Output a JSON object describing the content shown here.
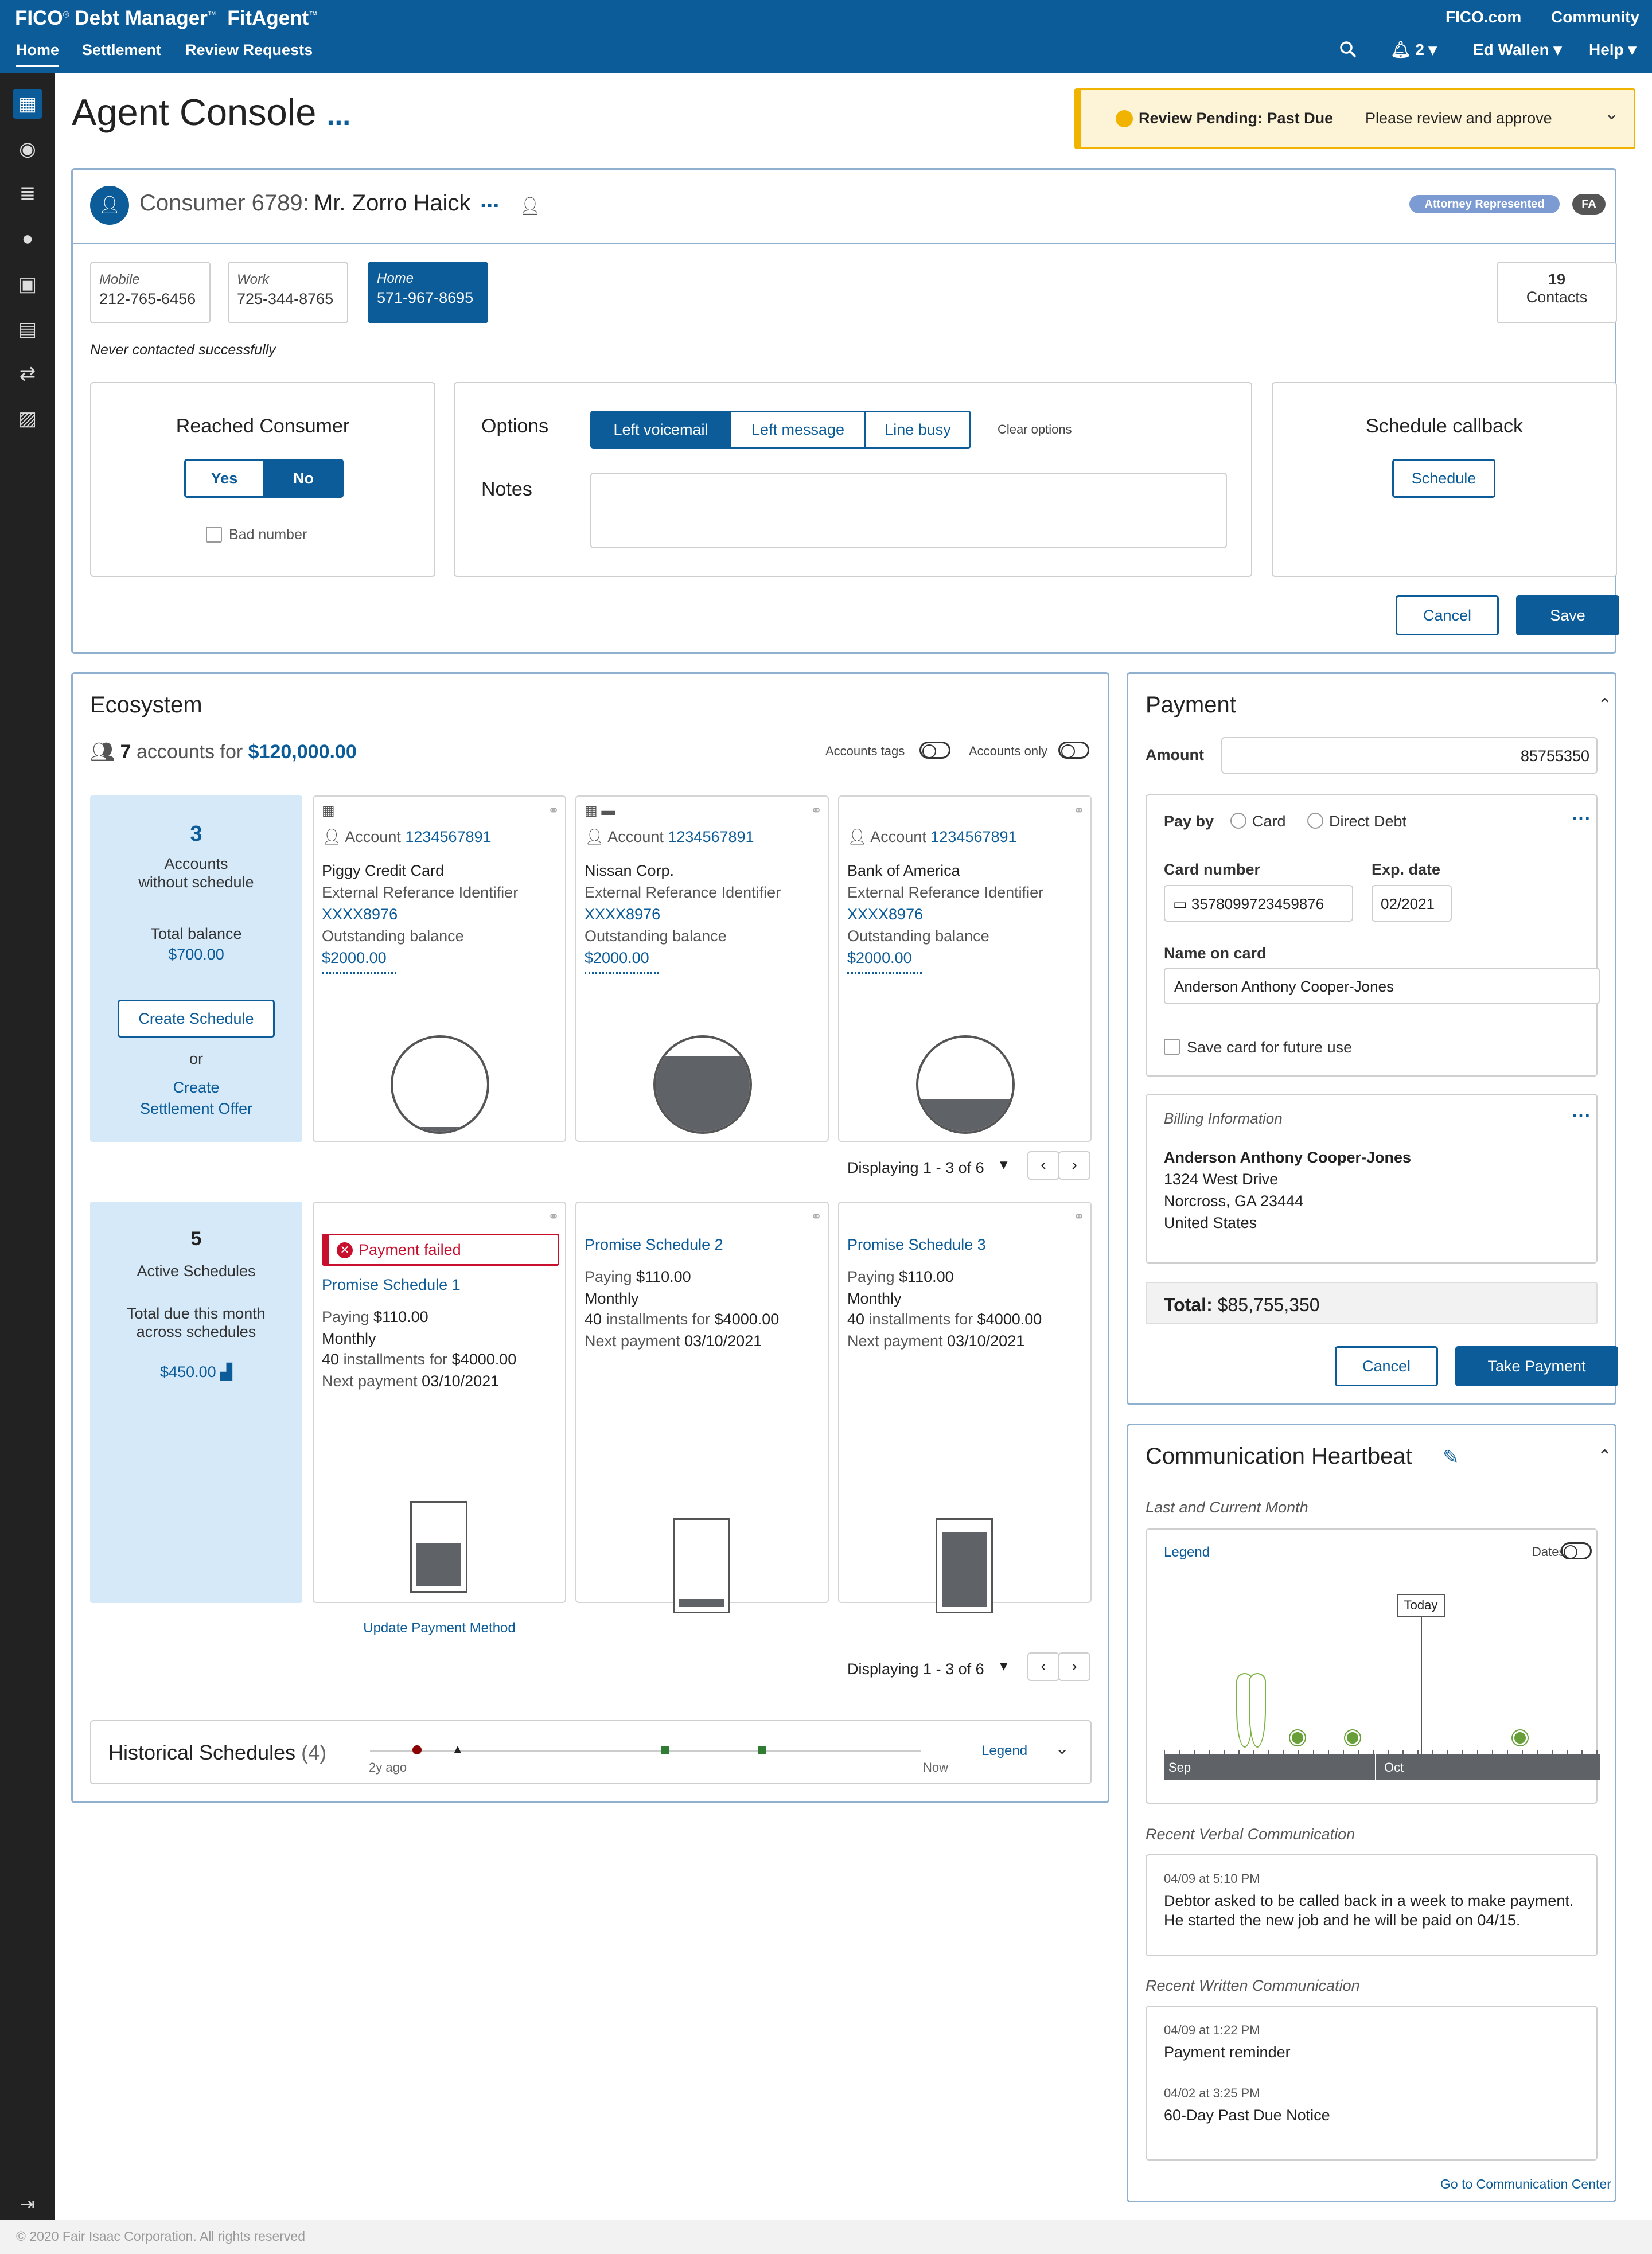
{
  "app": {
    "brand": "FICO",
    "brand_reg": "®",
    "product": "Debt Manager",
    "product_tm": "™",
    "sub": "FitAgent",
    "sub_tm": "™",
    "nav": [
      "Home",
      "Settlement",
      "Review Requests"
    ],
    "links": [
      "FICO.com",
      "Community"
    ],
    "notif_count": "2",
    "user": "Ed Wallen",
    "help": "Help"
  },
  "page": {
    "title": "Agent Console",
    "title_menu": "...",
    "alert": {
      "title": "Review Pending: Past Due",
      "text": "Please review and approve"
    }
  },
  "consumer": {
    "id_label": "Consumer 6789:",
    "name": "Mr. Zorro Haick",
    "menu": "...",
    "badges": {
      "attorney": "Attorney Represented",
      "fa": "FA"
    },
    "phones": [
      {
        "type": "Mobile",
        "number": "212-765-6456"
      },
      {
        "type": "Work",
        "number": "725-344-8765"
      },
      {
        "type": "Home",
        "number": "571-967-8695"
      }
    ],
    "contacts_count": "19",
    "contacts_label": "Contacts",
    "never_contacted": "Never contacted successfully",
    "reached": {
      "title": "Reached Consumer",
      "yes": "Yes",
      "no": "No",
      "bad_number": "Bad number"
    },
    "options": {
      "title": "Options",
      "buttons": [
        "Left voicemail",
        "Left message",
        "Line busy"
      ],
      "clear": "Clear options",
      "notes_label": "Notes",
      "notes_value": ""
    },
    "callback": {
      "title": "Schedule callback",
      "button": "Schedule"
    },
    "cancel": "Cancel",
    "save": "Save"
  },
  "ecosystem": {
    "title": "Ecosystem",
    "count": "7",
    "count_text": "accounts for",
    "total": "$120,000.00",
    "toggles": [
      "Accounts tags",
      "Accounts only"
    ],
    "summary1": {
      "num": "3",
      "line1": "Accounts",
      "line2": "without schedule",
      "total_label": "Total balance",
      "total": "$700.00",
      "create": "Create Schedule",
      "or": "or",
      "offer1": "Create",
      "offer2": "Settlement Offer"
    },
    "accounts": [
      {
        "acct_label": "Account",
        "acct_no": "1234567891",
        "name": "Piggy Credit Card",
        "ext_label": "External Referance Identifier",
        "ext": "XXXX8976",
        "bal_label": "Outstanding balance",
        "bal": "$2000.00",
        "gauge_fill": 0.05
      },
      {
        "acct_label": "Account",
        "acct_no": "1234567891",
        "name": "Nissan Corp.",
        "ext_label": "External Referance Identifier",
        "ext": "XXXX8976",
        "bal_label": "Outstanding balance",
        "bal": "$2000.00",
        "gauge_fill": 0.8
      },
      {
        "acct_label": "Account",
        "acct_no": "1234567891",
        "name": "Bank of America",
        "ext_label": "External Referance Identifier",
        "ext": "XXXX8976",
        "bal_label": "Outstanding balance",
        "bal": "$2000.00",
        "gauge_fill": 0.35
      }
    ],
    "displaying1": "Displaying 1 - 3 of 6",
    "summary2": {
      "num": "5",
      "line1": "Active Schedules",
      "line2": "Total due this month",
      "line3": "across schedules",
      "amount": "$450.00"
    },
    "schedules": [
      {
        "failed": "Payment failed",
        "name": "Promise Schedule 1",
        "paying_label": "Paying",
        "paying": "$110.00",
        "freq": "Monthly",
        "inst": "40",
        "inst_label": "installments for",
        "inst_total": "$4000.00",
        "next_label": "Next payment",
        "next": "03/10/2021",
        "fill": 0.55,
        "update": "Update Payment Method"
      },
      {
        "name": "Promise Schedule 2",
        "paying_label": "Paying",
        "paying": "$110.00",
        "freq": "Monthly",
        "inst": "40",
        "inst_label": "installments for",
        "inst_total": "$4000.00",
        "next_label": "Next payment",
        "next": "03/10/2021",
        "fill": 0.1
      },
      {
        "name": "Promise Schedule 3",
        "paying_label": "Paying",
        "paying": "$110.00",
        "freq": "Monthly",
        "inst": "40",
        "inst_label": "installments for",
        "inst_total": "$4000.00",
        "next_label": "Next payment",
        "next": "03/10/2021",
        "fill": 0.9
      }
    ],
    "displaying2": "Displaying 1 - 3 of 6",
    "historical": {
      "title": "Historical Schedules",
      "count": "(4)",
      "start": "2y ago",
      "end": "Now",
      "legend": "Legend"
    }
  },
  "payment": {
    "title": "Payment",
    "amount_label": "Amount",
    "amount": "85755350",
    "pay_by": "Pay by",
    "card": "Card",
    "debit": "Direct Debt",
    "card_number_label": "Card number",
    "card_number": "3578099723459876",
    "exp_label": "Exp. date",
    "exp": "02/2021",
    "name_label": "Name on card",
    "name": "Anderson Anthony Cooper-Jones",
    "save_card": "Save card for future use",
    "billing_title": "Billing Information",
    "billing": [
      "Anderson Anthony Cooper-Jones",
      "1324 West Drive",
      "Norcross, GA 23444",
      "United States"
    ],
    "total_label": "Total:",
    "total": "$85,755,350",
    "cancel": "Cancel",
    "take": "Take Payment"
  },
  "heartbeat": {
    "title": "Communication Heartbeat",
    "period": "Last and Current Month",
    "legend": "Legend",
    "dates": "Dates",
    "today": "Today",
    "months": [
      "Sep",
      "Oct"
    ],
    "verbal_title": "Recent Verbal Communication",
    "verbal_time": "04/09 at 5:10 PM",
    "verbal_text1": "Debtor asked to be called back in a week to make payment.",
    "verbal_text2": "He started the new job and he will be paid on 04/15.",
    "written_title": "Recent Written Communication",
    "written": [
      {
        "time": "04/09 at 1:22 PM",
        "text": "Payment reminder"
      },
      {
        "time": "04/02 at 3:25 PM",
        "text": "60-Day Past Due Notice"
      }
    ],
    "go": "Go to Communication Center"
  },
  "footer": "© 2020 Fair Isaac Corporation. All rights reserved"
}
